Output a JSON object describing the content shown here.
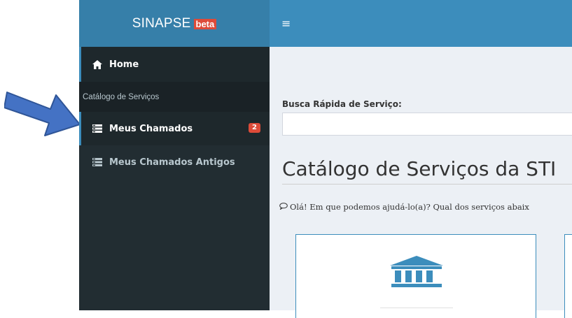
{
  "app": {
    "logo_text": "SINAPSE",
    "logo_badge": "beta"
  },
  "topbar": {
    "menu_toggle": "≡"
  },
  "sidebar": {
    "home_label": "Home",
    "section_header": "Catálogo de Serviços",
    "items": [
      {
        "label": "Meus Chamados",
        "badge": "2",
        "icon": "list-icon",
        "active": true
      },
      {
        "label": "Meus Chamados Antigos",
        "icon": "list-icon",
        "active": false
      }
    ]
  },
  "content": {
    "search_label": "Busca Rápida de Serviço:",
    "search_value": "",
    "title": "Catálogo de Serviços da STI",
    "subtitle": "Olá! Em que podemos ajudá-lo(a)? Qual dos serviços abaix"
  },
  "icons": {
    "home": "home-icon",
    "card": "bank-icon",
    "subtitle": "chat-bubble-icon",
    "annotation": "arrow-annotation"
  },
  "colors": {
    "sidebar_bg": "#222d32",
    "logo_bg": "#367fa9",
    "topbar_bg": "#3c8dbc",
    "badge_red": "#dd4b39",
    "content_bg": "#ecf0f5",
    "annotation_arrow": "#4472c4"
  }
}
